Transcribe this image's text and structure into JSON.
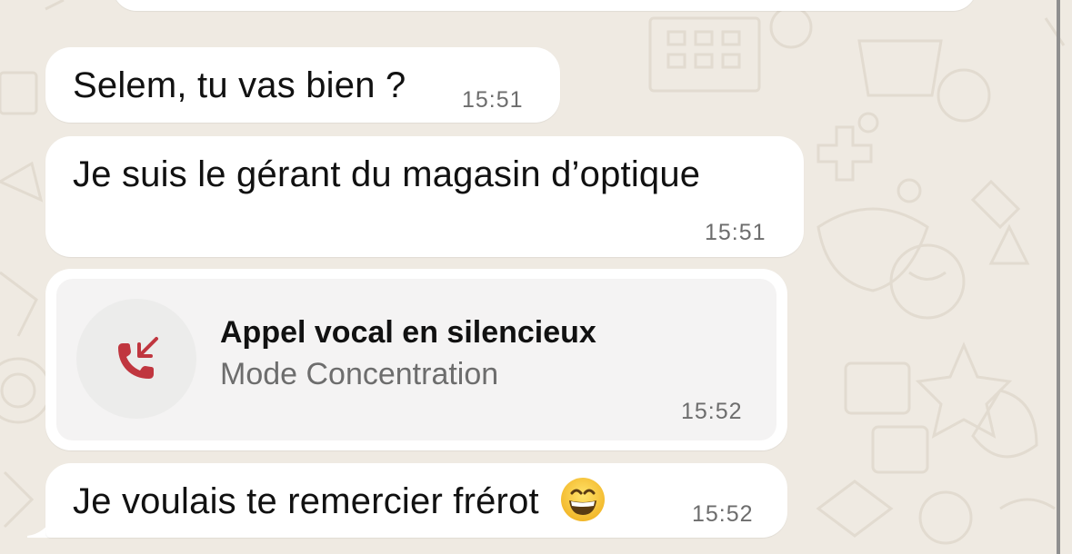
{
  "messages": [
    {
      "text": "Selem, tu vas bien ?",
      "time": "15:51"
    },
    {
      "text": "Je suis le gérant du magasin d’optique",
      "time": "15:51"
    },
    {
      "type": "call",
      "title": "Appel vocal en silencieux",
      "subtitle": "Mode Concentration",
      "time": "15:52",
      "icon": "missed-call-icon",
      "icon_color": "#c0363f"
    },
    {
      "text": "Je voulais te remercier frérot",
      "emoji": "grinning-face-emoji",
      "time": "15:52"
    }
  ],
  "colors": {
    "background": "#efeae2",
    "bubble": "#ffffff",
    "call_card": "#f4f3f3",
    "timestamp": "#6d6d6d"
  }
}
